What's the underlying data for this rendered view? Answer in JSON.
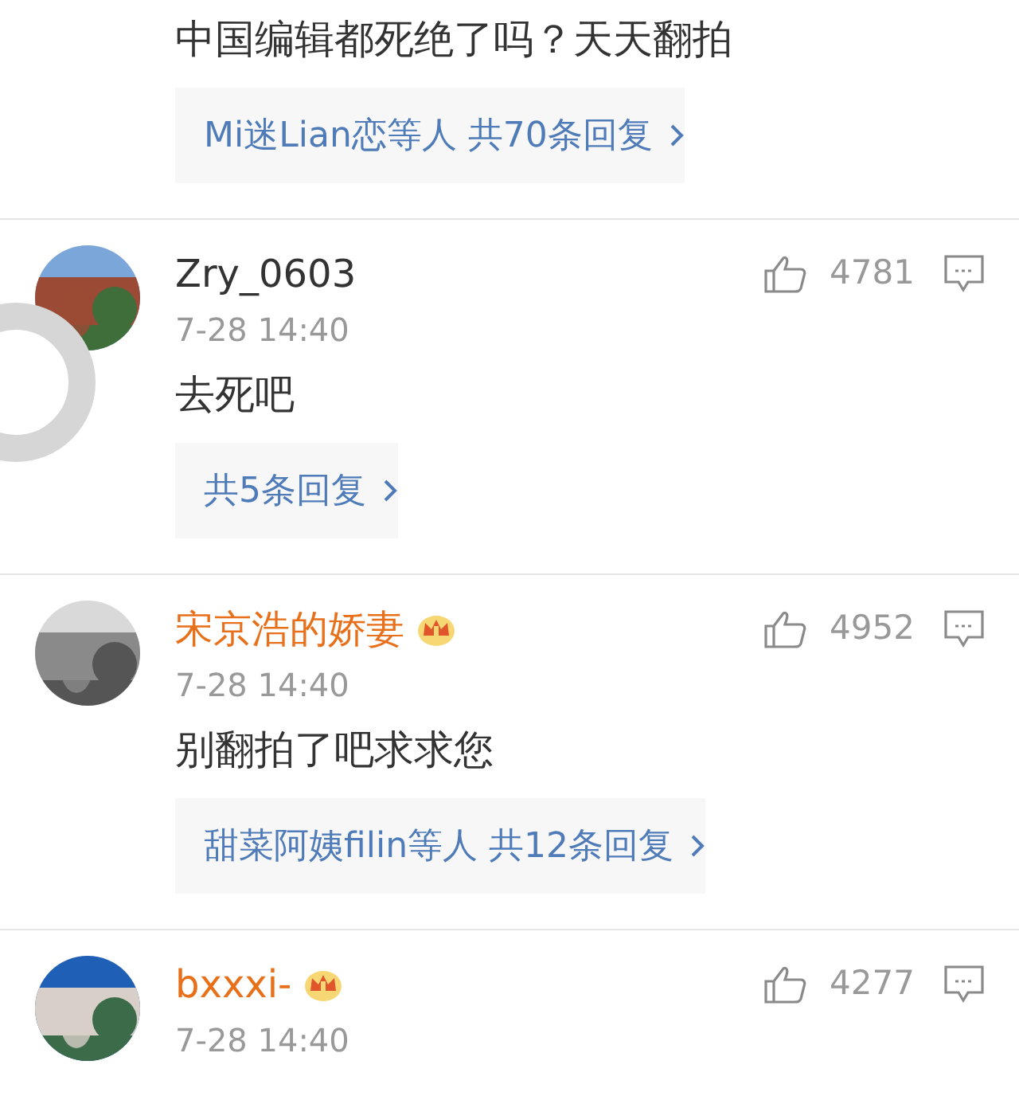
{
  "top_comment": {
    "text": "中国编辑都死绝了吗？天天翻拍",
    "replies": {
      "summary": "Mi迷Lian恋等人 共70条回复"
    }
  },
  "comments": [
    {
      "user": "Zry_0603",
      "vip": false,
      "time": "7-28 14:40",
      "likes": "4781",
      "text": "去死吧",
      "replies": {
        "summary": "共5条回复"
      }
    },
    {
      "user": "宋京浩的娇妻",
      "vip": true,
      "time": "7-28 14:40",
      "likes": "4952",
      "text": "别翻拍了吧求求您",
      "replies": {
        "summary": "甜菜阿姨filin等人 共12条回复"
      }
    },
    {
      "user": "bxxxi-",
      "vip": true,
      "time": "7-28 14:40",
      "likes": "4277"
    }
  ]
}
